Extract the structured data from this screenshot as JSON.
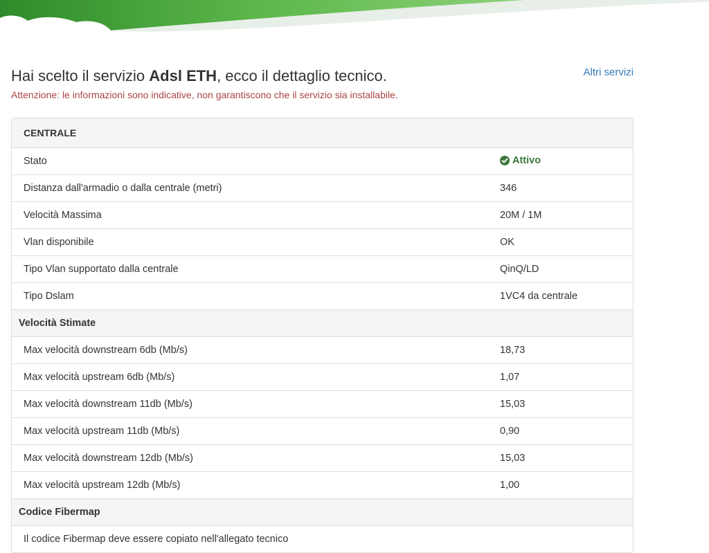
{
  "header": {
    "title_prefix": "Hai scelto il servizio ",
    "service_name": "Adsl ETH",
    "title_suffix": ", ecco il dettaglio tecnico.",
    "other_services_link": "Altri servizi",
    "warning": "Attenzione: le informazioni sono indicative, non garantiscono che il servizio sia installabile."
  },
  "panel": {
    "heading": "CENTRALE",
    "rows": [
      {
        "label": "Stato",
        "value": "Attivo"
      },
      {
        "label": "Distanza dall'armadio o dalla centrale (metri)",
        "value": "346"
      },
      {
        "label": "Velocità Massima",
        "value": "20M / 1M"
      },
      {
        "label": "Vlan disponibile",
        "value": "OK"
      },
      {
        "label": "Tipo Vlan supportato dalla centrale",
        "value": "QinQ/LD"
      },
      {
        "label": "Tipo Dslam",
        "value": "1VC4 da centrale"
      }
    ],
    "speed_section": {
      "title": "Velocità Stimate",
      "rows": [
        {
          "label": "Max velocità downstream 6db (Mb/s)",
          "value": "18,73"
        },
        {
          "label": "Max velocità upstream 6db (Mb/s)",
          "value": "1,07"
        },
        {
          "label": "Max velocità downstream 11db (Mb/s)",
          "value": "15,03"
        },
        {
          "label": "Max velocità upstream 11db (Mb/s)",
          "value": "0,90"
        },
        {
          "label": "Max velocità downstream 12db (Mb/s)",
          "value": "15,03"
        },
        {
          "label": "Max velocità upstream 12db (Mb/s)",
          "value": "1,00"
        }
      ]
    },
    "fibermap_section": {
      "title": "Codice Fibermap",
      "note": "Il codice Fibermap deve essere copiato nell'allegato tecnico"
    }
  },
  "colors": {
    "status_active": "#3c763d",
    "warning": "#a94442",
    "link": "#337ab7",
    "banner_green": "#3f9b35"
  }
}
